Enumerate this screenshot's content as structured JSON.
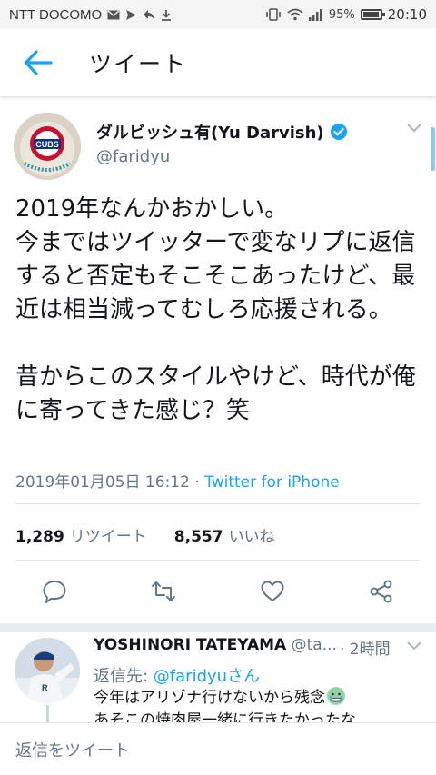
{
  "status_bar": {
    "carrier": "NTT DOCOMO",
    "battery_percent": "95%",
    "battery_level": 0.95,
    "time": "20:10",
    "icons": [
      "mail-icon",
      "message-icon",
      "reply-notification-icon",
      "download-icon",
      "vibrate-icon",
      "wifi-icon",
      "signal-icon",
      "battery-icon"
    ]
  },
  "app_bar": {
    "back_icon": "arrow-left-icon",
    "title": "ツイート"
  },
  "tweet": {
    "display_name": "ダルビッシュ有(Yu Darvish)",
    "handle": "@faridyu",
    "verified": true,
    "avatar_logo_text": "CUBS",
    "text": "2019年なんかおかしい。\n今まではツイッターで変なリプに返信すると否定もそこそこあったけど、最近は相当減ってむしろ応援される。\n\n昔からこのスタイルやけど、時代が俺に寄ってきた感じ？笑",
    "timestamp": "2019年01月05日 16:12",
    "separator": " · ",
    "source": "Twitter for iPhone",
    "retweet_count": "1,289",
    "retweet_label": "リツイート",
    "like_count": "8,557",
    "like_label": "いいね",
    "actions": [
      "reply-icon",
      "retweet-icon",
      "like-icon",
      "share-icon"
    ]
  },
  "reply": {
    "name": "YOSHINORI TATEYAMA",
    "handle": "@ta...",
    "time": "· 2時間",
    "reply_to_prefix": "返信先: ",
    "reply_to_mention": "@faridyuさん",
    "body_line1": "今年はアリゾナ行けないから残念",
    "body_line2": "あそこの焼肉屋一緒に行きたかったな"
  },
  "compose": {
    "placeholder": "返信をツイート"
  },
  "colors": {
    "accent": "#1da1f2",
    "text_primary": "#14171a",
    "text_secondary": "#657786",
    "divider": "#e1e8ed"
  }
}
